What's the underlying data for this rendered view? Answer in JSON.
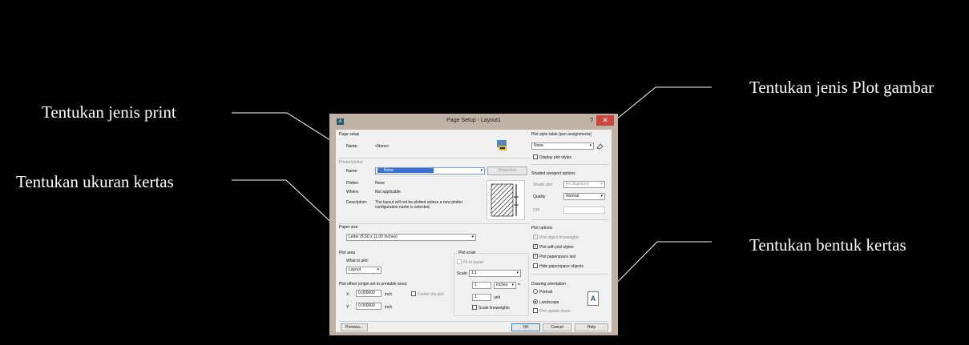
{
  "annotations": {
    "print_type": "Tentukan jenis print",
    "plot_type": "Tentukan jenis Plot gambar",
    "paper_size": "Tentukan ukuran kertas",
    "paper_orientation": "Tentukan bentuk kertas"
  },
  "dialog": {
    "title": "Page Setup - Layout1",
    "app_icon": "A",
    "help": "?",
    "close": "✕",
    "page_setup": {
      "heading": "Page setup",
      "name_label": "Name:",
      "name_value": "<None>"
    },
    "printer": {
      "heading": "Printer/plotter",
      "name_label": "Name:",
      "name_value": "None",
      "properties": "Properties",
      "plotter_label": "Plotter:",
      "plotter_value": "None",
      "where_label": "Where:",
      "where_value": "Not applicable",
      "description_label": "Description:",
      "description_value_1": "The layout will not be plotted unless a new plotter",
      "description_value_2": "configuration name is selected."
    },
    "paper_size": {
      "heading": "Paper size",
      "value": "Letter (8.50 x 11.00 Inches)"
    },
    "plot_area": {
      "heading": "Plot area",
      "what_label": "What to plot:",
      "what_value": "Layout"
    },
    "plot_offset": {
      "heading": "Plot offset (origin set to printable area)",
      "x_label": "X:",
      "x_value": "0.000000",
      "x_unit": "inch",
      "y_label": "Y:",
      "y_value": "0.000000",
      "y_unit": "inch",
      "center": "Center the plot"
    },
    "plot_scale": {
      "heading": "Plot scale",
      "fit": "Fit to paper",
      "scale_label": "Scale:",
      "scale_value": "1:1",
      "val1": "1",
      "unit1": "inches",
      "val2": "1",
      "unit2": "unit",
      "lineweights": "Scale lineweights"
    },
    "plot_style": {
      "heading": "Plot style table (pen assignments)",
      "value": "None",
      "display": "Display plot styles"
    },
    "shaded": {
      "heading": "Shaded viewport options",
      "shade_label": "Shade plot",
      "shade_value": "As displayed",
      "quality_label": "Quality",
      "quality_value": "Normal",
      "dpi_label": "DPI"
    },
    "plot_options": {
      "heading": "Plot options",
      "opt1": "Plot object lineweights",
      "opt2": "Plot with plot styles",
      "opt3": "Plot paperspace last",
      "opt4": "Hide paperspace objects"
    },
    "orientation": {
      "heading": "Drawing orientation",
      "portrait": "Portrait",
      "landscape": "Landscape",
      "upside": "Plot upside-down",
      "icon_glyph": "A"
    },
    "buttons": {
      "preview": "Preview...",
      "ok": "OK",
      "cancel": "Cancel",
      "help": "Help"
    }
  }
}
